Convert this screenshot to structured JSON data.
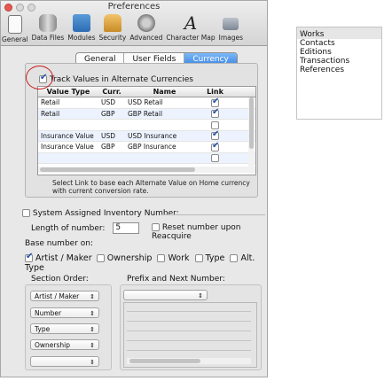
{
  "window": {
    "title": "Preferences"
  },
  "toolbar": {
    "items": [
      {
        "label": "General",
        "icon": "general-icon"
      },
      {
        "label": "Data Files",
        "icon": "database-icon"
      },
      {
        "label": "Modules",
        "icon": "modules-icon"
      },
      {
        "label": "Security",
        "icon": "lock-icon"
      },
      {
        "label": "Advanced",
        "icon": "gear-icon"
      },
      {
        "label": "Character Map",
        "icon": "character-map-icon",
        "glyph": "A"
      },
      {
        "label": "Images",
        "icon": "camera-icon"
      }
    ]
  },
  "tabs": {
    "items": [
      "General",
      "User Fields",
      "Currency"
    ],
    "active": "Currency"
  },
  "currency": {
    "track_label": "Track Values in Alternate Currencies",
    "track_checked": true,
    "headers": {
      "type": "Value Type",
      "curr": "Curr.",
      "name": "Name",
      "link": "Link"
    },
    "rows": [
      {
        "type": "Retail",
        "curr": "USD",
        "name": "USD Retail",
        "link": true
      },
      {
        "type": "Retail",
        "curr": "GBP",
        "name": "GBP Retail",
        "link": true
      },
      {
        "type": "",
        "curr": "",
        "name": "",
        "link": false
      },
      {
        "type": "Insurance Value",
        "curr": "USD",
        "name": "USD Insurance",
        "link": true
      },
      {
        "type": "Insurance Value",
        "curr": "GBP",
        "name": "GBP Insurance",
        "link": true
      },
      {
        "type": "",
        "curr": "",
        "name": "",
        "link": false
      }
    ],
    "note": "Select Link to base each Alternate Value on Home currency with current conversion rate."
  },
  "inventory": {
    "system_assigned_label": "System Assigned Inventory Number:",
    "system_assigned_checked": false,
    "length_label": "Length of number:",
    "length_value": "5",
    "reset_label": "Reset number upon Reacquire",
    "reset_checked": false,
    "base_label": "Base number on:",
    "base_options": [
      {
        "label": "Artist / Maker",
        "checked": true
      },
      {
        "label": "Ownership",
        "checked": false
      },
      {
        "label": "Work",
        "checked": false
      },
      {
        "label": "Type",
        "checked": false
      },
      {
        "label": "Alt. Type",
        "checked": false
      }
    ]
  },
  "section_order": {
    "label": "Section Order:",
    "popups": [
      "Artist / Maker",
      "Number",
      "Type",
      "Ownership",
      ""
    ]
  },
  "prefix": {
    "label": "Prefix and Next Number:",
    "popup_value": ""
  },
  "side_list": {
    "items": [
      "Works",
      "Contacts",
      "Editions",
      "Transactions",
      "References"
    ],
    "selected": "Works"
  }
}
